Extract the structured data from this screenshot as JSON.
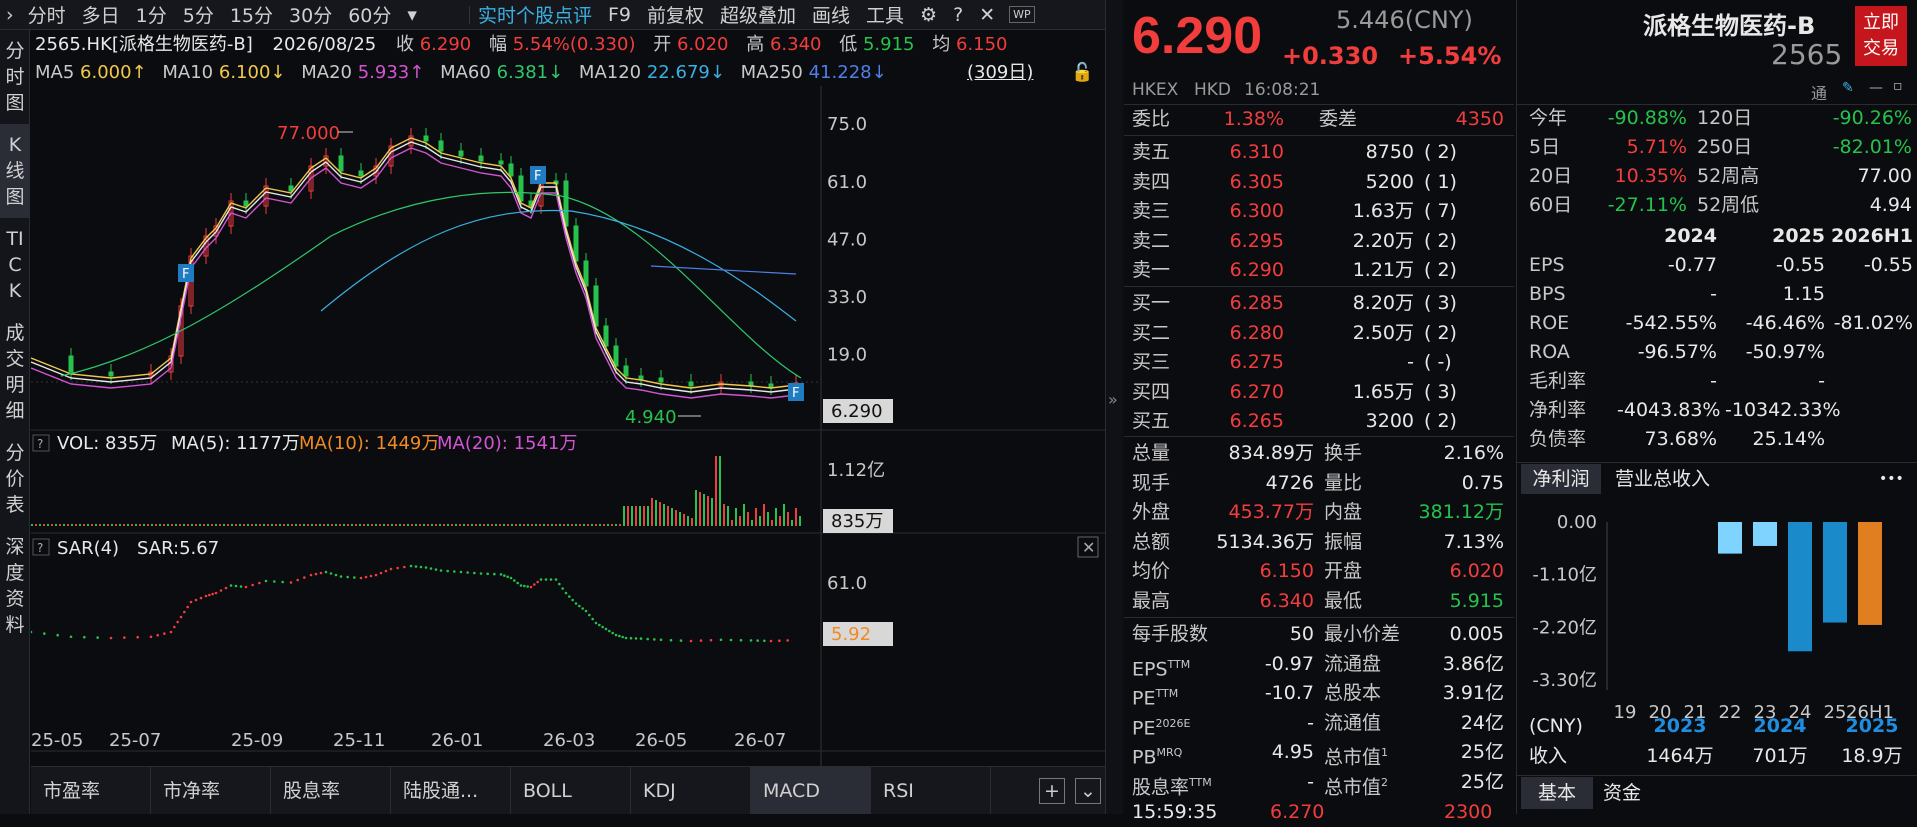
{
  "toolbar": {
    "items": [
      "分时",
      "多日",
      "1分",
      "5分",
      "15分",
      "30分",
      "60分"
    ],
    "dropdown": "▾",
    "right_items": [
      "实时个股点评",
      "F9",
      "前复权",
      "超级叠加",
      "画线",
      "工具"
    ]
  },
  "sidebar": {
    "items": [
      "分时图",
      "K线图",
      "TICK",
      "成交明细",
      "分价表",
      "深度资料"
    ]
  },
  "info": {
    "code": "2565.HK[派格生物医药-B]",
    "date": "2026/08/25",
    "close_label": "收",
    "close": "6.290",
    "range_label": "幅",
    "range": "5.54%(0.330)",
    "open_label": "开",
    "open": "6.020",
    "high_label": "高",
    "high": "6.340",
    "low_label": "低",
    "low": "5.915",
    "avg_label": "均",
    "avg": "6.150"
  },
  "ma": {
    "ma5": "MA5",
    "ma5_val": "6.000↑",
    "ma10": "MA10",
    "ma10_val": "6.100↓",
    "ma20": "MA20",
    "ma20_val": "5.933↑",
    "ma60": "MA60",
    "ma60_val": "6.381↓",
    "ma120": "MA120",
    "ma120_val": "22.679↓",
    "ma250": "MA250",
    "ma250_val": "41.228↓",
    "period": "(309日)"
  },
  "kchart": {
    "y_ticks": [
      "75.0",
      "61.0",
      "47.0",
      "33.0",
      "19.0"
    ],
    "max_label": "77.000",
    "min_label": "4.940",
    "last_price": "6.290",
    "f_marker": "F",
    "x_ticks": [
      "25-05",
      "25-07",
      "25-09",
      "25-11",
      "26-01",
      "26-03",
      "26-05",
      "26-07"
    ]
  },
  "vol": {
    "label": "VOL: 835万",
    "ma5": "MA(5): 1177万",
    "ma10": "MA(10): 1449万",
    "ma20": "MA(20): 1541万",
    "tick": "1.12亿",
    "last": "835万"
  },
  "sar": {
    "label": "SAR(4)",
    "value": "SAR:5.67",
    "tick": "61.0",
    "last": "5.92"
  },
  "bottom_tabs": [
    "市盈率",
    "市净率",
    "股息率",
    "陆股通...",
    "BOLL",
    "KDJ",
    "MACD",
    "RSI"
  ],
  "quote": {
    "price": "6.290",
    "cny": "5.446(CNY)",
    "change": "+0.330",
    "pct": "+5.54%",
    "market": "HKEX",
    "currency": "HKD",
    "time": "16:08:21",
    "weibi_label": "委比",
    "weibi": "1.38%",
    "weicha_label": "委差",
    "weicha": "4350",
    "asks": [
      {
        "label": "卖五",
        "price": "6.310",
        "vol": "8750",
        "n": "2"
      },
      {
        "label": "卖四",
        "price": "6.305",
        "vol": "5200",
        "n": "1"
      },
      {
        "label": "卖三",
        "price": "6.300",
        "vol": "1.63万",
        "n": "7"
      },
      {
        "label": "卖二",
        "price": "6.295",
        "vol": "2.20万",
        "n": "2"
      },
      {
        "label": "卖一",
        "price": "6.290",
        "vol": "1.21万",
        "n": "2"
      }
    ],
    "bids": [
      {
        "label": "买一",
        "price": "6.285",
        "vol": "8.20万",
        "n": "3"
      },
      {
        "label": "买二",
        "price": "6.280",
        "vol": "2.50万",
        "n": "2"
      },
      {
        "label": "买三",
        "price": "6.275",
        "vol": "-",
        "n": "-"
      },
      {
        "label": "买四",
        "price": "6.270",
        "vol": "1.65万",
        "n": "3"
      },
      {
        "label": "买五",
        "price": "6.265",
        "vol": "3200",
        "n": "2"
      }
    ],
    "stats": [
      {
        "l1": "总量",
        "v1": "834.89万",
        "l2": "换手",
        "v2": "2.16%"
      },
      {
        "l1": "现手",
        "v1": "4726",
        "l2": "量比",
        "v2": "0.75"
      },
      {
        "l1": "外盘",
        "v1": "453.77万",
        "l2": "内盘",
        "v2": "381.12万"
      },
      {
        "l1": "总额",
        "v1": "5134.36万",
        "l2": "振幅",
        "v2": "7.13%"
      },
      {
        "l1": "均价",
        "v1": "6.150",
        "l2": "开盘",
        "v2": "6.020"
      },
      {
        "l1": "最高",
        "v1": "6.340",
        "l2": "最低",
        "v2": "5.915"
      }
    ],
    "stats2": [
      {
        "l1": "每手股数",
        "v1": "50",
        "l2": "最小价差",
        "v2": "0.005"
      },
      {
        "l1": "EPS",
        "s1": "TTM",
        "v1": "-0.97",
        "l2": "流通盘",
        "v2": "3.86亿"
      },
      {
        "l1": "PE",
        "s1": "TTM",
        "v1": "-10.7",
        "l2": "总股本",
        "v2": "3.91亿"
      },
      {
        "l1": "PE",
        "s1": "2026E",
        "v1": "-",
        "l2": "流通值",
        "v2": "24亿"
      },
      {
        "l1": "PB",
        "s1": "MRQ",
        "v1": "4.95",
        "l2": "总市值",
        "s2": "1",
        "v2": "25亿"
      },
      {
        "l1": "股息率",
        "s1": "TTM",
        "v1": "-",
        "l2": "总市值",
        "s2": "2",
        "v2": "25亿"
      }
    ],
    "trade_time": "15:59:35",
    "trade_price": "6.270",
    "trade_vol": "2300"
  },
  "right": {
    "name": "派格生物医药-B",
    "code": "2565",
    "trade_btn": "立即交易",
    "tong": "通",
    "perf": [
      {
        "l1": "今年",
        "v1": "-90.88%",
        "l2": "120日",
        "v2": "-90.26%"
      },
      {
        "l1": "5日",
        "v1": "5.71%",
        "l2": "250日",
        "v2": "-82.01%"
      },
      {
        "l1": "20日",
        "v1": "10.35%",
        "l2": "52周高",
        "v2": "77.00"
      },
      {
        "l1": "60日",
        "v1": "-27.11%",
        "l2": "52周低",
        "v2": "4.94"
      }
    ],
    "fin_headers": [
      "2024",
      "2025",
      "2026H1"
    ],
    "fin": [
      {
        "label": "EPS",
        "v": [
          "-0.77",
          "-0.55",
          "-0.55"
        ]
      },
      {
        "label": "BPS",
        "v": [
          "-",
          "1.15",
          ""
        ]
      },
      {
        "label": "ROE",
        "v": [
          "-542.55%",
          "-46.46%",
          "-81.02%"
        ]
      },
      {
        "label": "ROA",
        "v": [
          "-96.57%",
          "-50.97%",
          ""
        ]
      },
      {
        "label": "毛利率",
        "v": [
          "-",
          "-",
          ""
        ]
      },
      {
        "label": "净利率",
        "v": [
          "-4043.83%",
          "-10342.33%",
          ""
        ]
      },
      {
        "label": "负债率",
        "v": [
          "73.68%",
          "25.14%",
          ""
        ]
      }
    ],
    "tabs": [
      "净利润",
      "营业总收入"
    ],
    "more": "•••",
    "bottom_tabs": [
      "基本",
      "资金"
    ]
  },
  "chart_data": {
    "type": "bar",
    "title": "净利润",
    "categories": [
      "19",
      "20",
      "21",
      "22",
      "23",
      "24",
      "25",
      "26H1"
    ],
    "values": [
      null,
      null,
      null,
      -0.66,
      -0.5,
      -2.7,
      -2.1,
      -2.15
    ],
    "ylim": [
      -3.3,
      0
    ],
    "y_ticks": [
      "0.00",
      "-1.10亿",
      "-2.20亿",
      "-3.30亿"
    ],
    "year_labels": [
      "2023",
      "2024",
      "2025"
    ],
    "currency": "(CNY)",
    "revenue_label": "收入",
    "revenue": [
      "1464万",
      "701万",
      "18.9万"
    ]
  }
}
